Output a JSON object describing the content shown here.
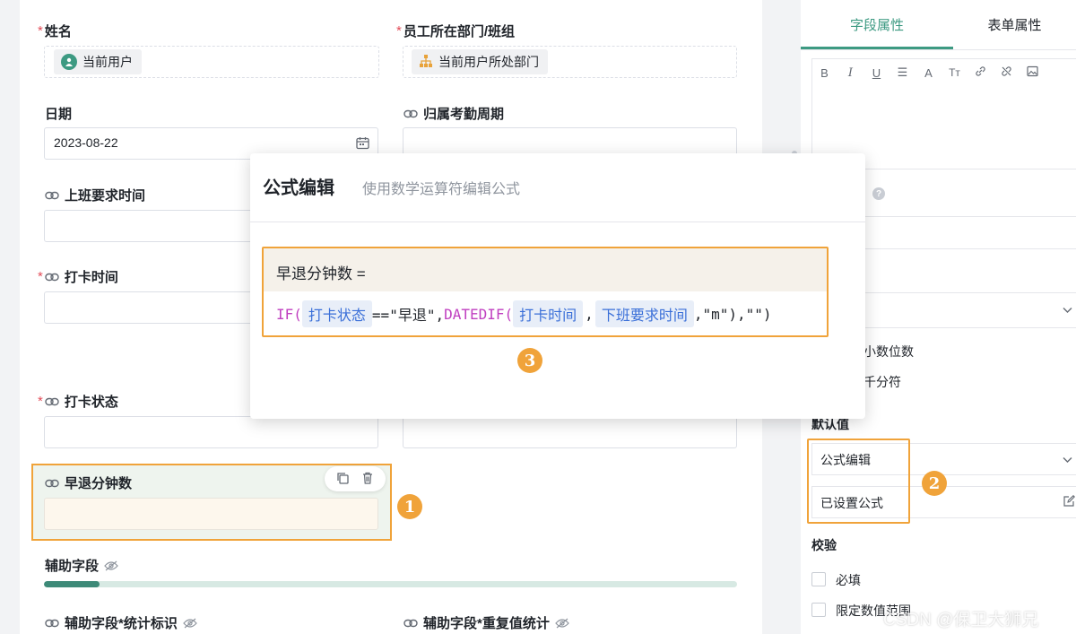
{
  "form": {
    "name_label": "姓名",
    "name_chip": "当前用户",
    "dept_label": "员工所在部门/班组",
    "dept_chip": "当前用户所处部门",
    "date_label": "日期",
    "date_value": "2023-08-22",
    "cycle_label": "归属考勤周期",
    "work_time_label": "上班要求时间",
    "punch_time_label": "打卡时间",
    "punch_status_label": "打卡状态",
    "early_label": "早退分钟数",
    "aux_label": "辅助字段",
    "aux_stat_label": "辅助字段*统计标识",
    "aux_dup_label": "辅助字段*重复值统计",
    "aux_progress": 0.08
  },
  "modal": {
    "title": "公式编辑",
    "subtitle": "使用数学运算符编辑公式",
    "formula_head": "早退分钟数 =",
    "formula": {
      "fn1": "IF(",
      "tok1": "打卡状态",
      "eq": "==\"早退\",",
      "fn2": "DATEDIF(",
      "tok2": "打卡时间",
      "comma": ",",
      "tok3": "下班要求时间",
      "tail": ",\"m\"),\"\")"
    }
  },
  "panel": {
    "tab_field": "字段属性",
    "tab_form": "表单属性",
    "decimal": "小数位数",
    "thousand": "千分符",
    "default_label": "默认值",
    "default_select": "公式编辑",
    "formula_set": "已设置公式",
    "validate_label": "校验",
    "required": "必填",
    "range": "限定数值范围"
  },
  "badges": [
    "1",
    "2",
    "3"
  ],
  "watermark": "CSDN @保卫大狮兄",
  "colors": {
    "accent": "#3d9a82",
    "highlight": "#f0a33a",
    "formula_fn": "#c040c0",
    "token": "#3a6fd8"
  }
}
